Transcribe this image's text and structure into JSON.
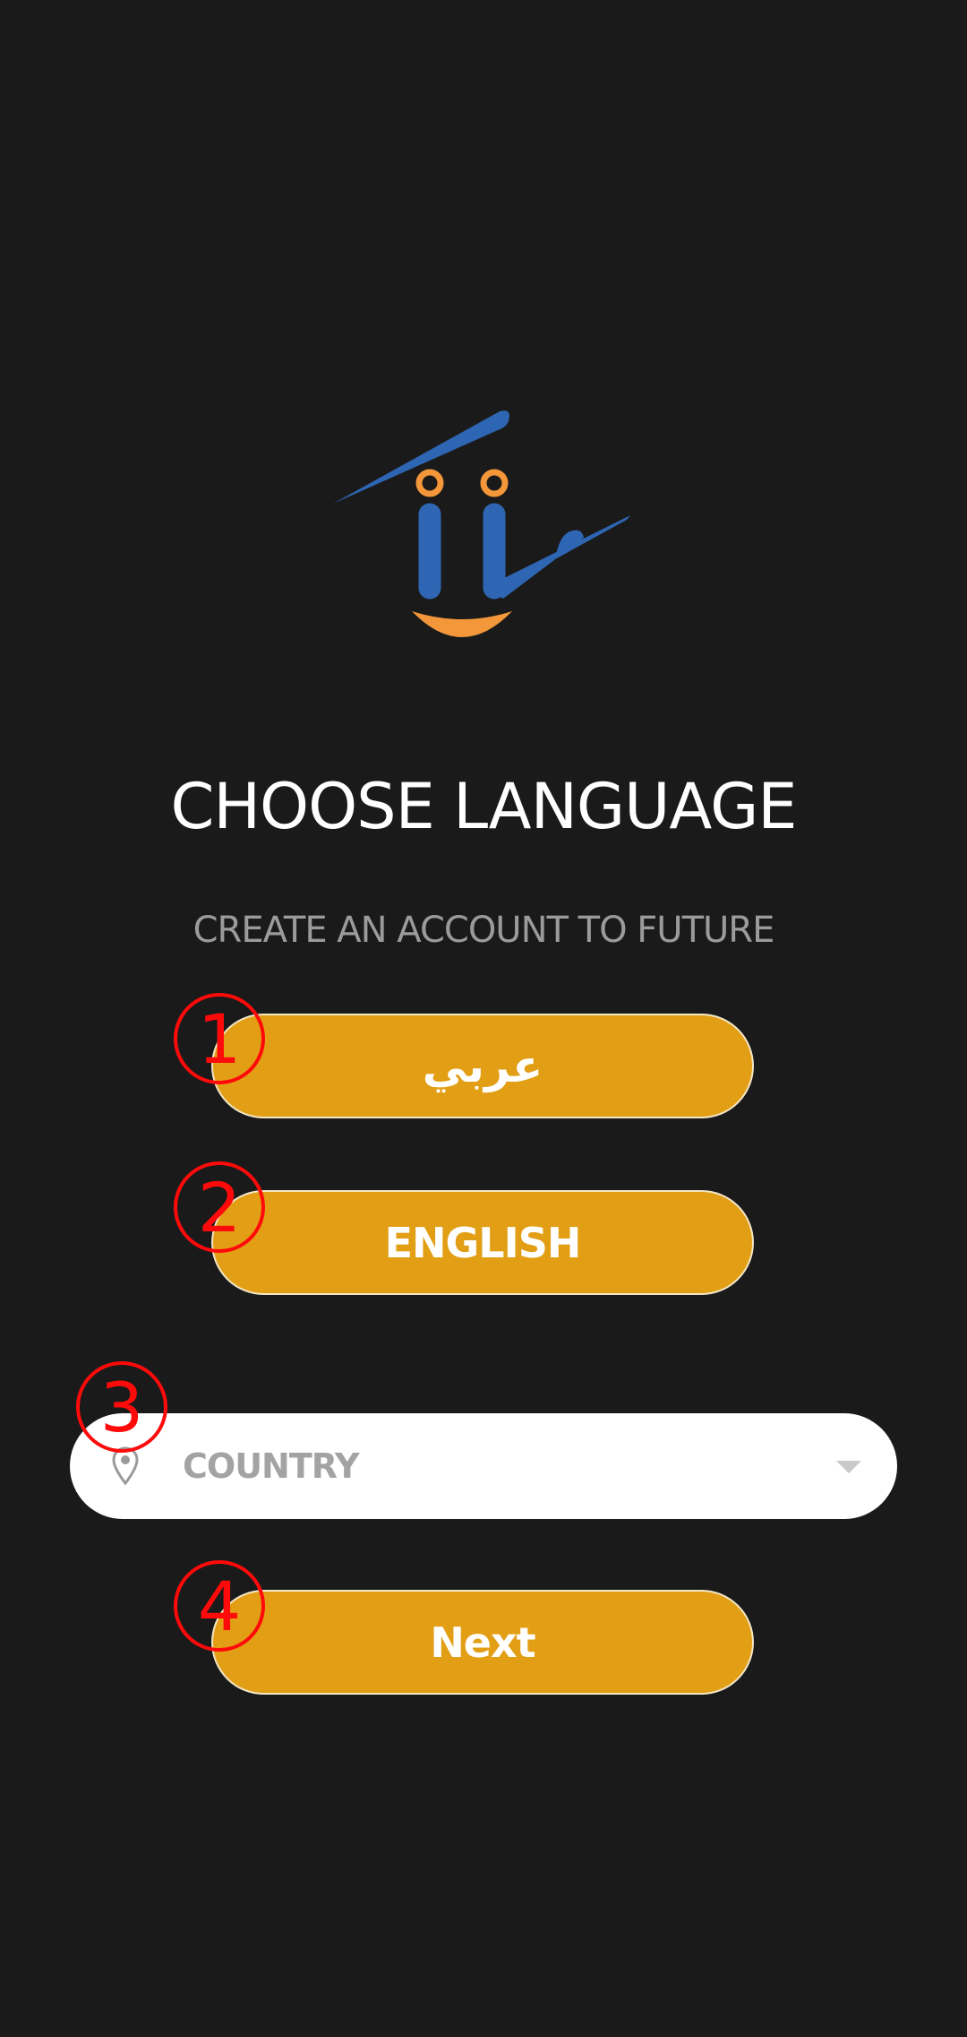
{
  "logo": {
    "name": "logo-icon"
  },
  "heading": {
    "title": "CHOOSE LANGUAGE",
    "subtitle": "CREATE AN ACCOUNT TO FUTURE"
  },
  "buttons": {
    "arabic_label": "عربي",
    "english_label": "ENGLISH",
    "next_label": "Next"
  },
  "country_select": {
    "label": "COUNTRY",
    "icon": "location-pin-icon",
    "dropdown_icon": "caret-down-icon"
  },
  "annotations": [
    "1",
    "2",
    "3",
    "4"
  ],
  "colors": {
    "background": "#1a1a1a",
    "button": "#e29f15",
    "logo_blue": "#2e66b3",
    "logo_orange": "#f3973a",
    "annotation": "#ff0a0a"
  }
}
